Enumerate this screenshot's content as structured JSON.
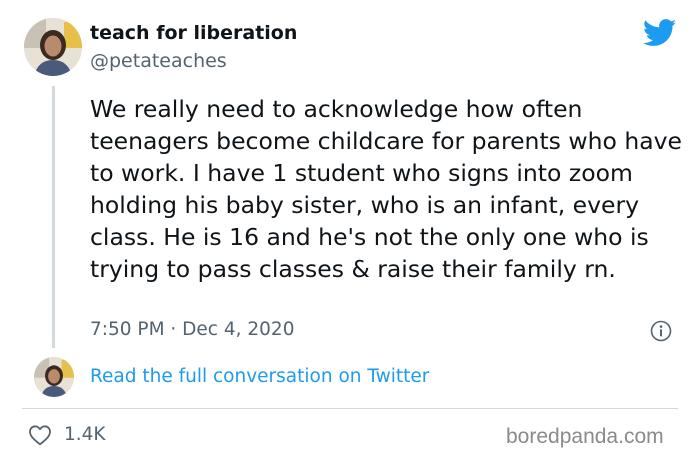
{
  "tweet": {
    "display_name": "teach for liberation",
    "handle": "@petateaches",
    "text": "We really need to acknowledge how often teenagers become childcare for parents who have to work. I have 1 student who signs into zoom holding his baby sister, who is an infant, every class. He is 16 and he's not the only one who is trying to pass classes & raise their family rn.",
    "timestamp": "7:50 PM · Dec 4, 2020"
  },
  "conversation_link": "Read the full conversation on Twitter",
  "likes": "1.4K",
  "watermark": "boredpanda.com",
  "icons": {
    "brand": "twitter-bird-icon",
    "info": "info-icon",
    "like": "heart-icon"
  },
  "colors": {
    "link": "#1d9bf0",
    "brand": "#1d9bf0",
    "secondary_text": "#536471",
    "primary_text": "#0f1419"
  }
}
